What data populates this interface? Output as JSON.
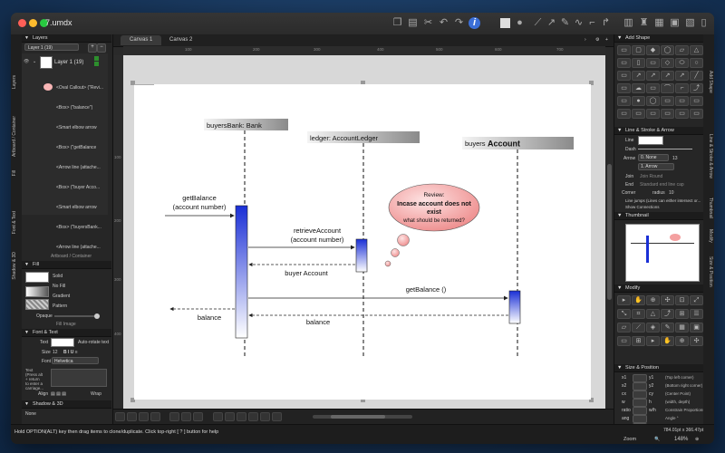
{
  "window": {
    "title": "7.umdx"
  },
  "layers_panel": {
    "title": "Layers",
    "layer_select": "Layer 1 (19)",
    "layer_name": "Layer 1 (19)",
    "items": [
      "<Oval Callout> (\"Revi...",
      "<Box> (\"balance\")",
      "<Smart elbow arrow",
      "<Box> (\"getBalance",
      "<Arrow line (attache...",
      "<Box> (\"buyer Acco...",
      "<Smart elbow arrow",
      "<Box> (\"buyersBank...",
      "<Arrow line (attache..."
    ],
    "artboard_label": "Artboard / Container"
  },
  "left_tabs": [
    "Layers",
    "Artboard / Container",
    "Fill",
    "Font & Text",
    "Shadow & 3D"
  ],
  "fill_panel": {
    "title": "Fill",
    "options": [
      "Solid",
      "No Fill",
      "Gradient",
      "Pattern"
    ],
    "opaque_label": "Opaque",
    "image_label": "Fill Image"
  },
  "font_panel": {
    "title": "Font & Text",
    "text_label": "Text",
    "auto_rotate": "Auto-rotate text",
    "size_label": "Size",
    "size_value": "12",
    "font_label": "Font",
    "font_value": "Helvetica",
    "text_note": "Text\n(Press alt\n+ return\nto enter a\ncarriage...",
    "align_label": "Align",
    "wrap_label": "Wrap",
    "hint_label": "Text"
  },
  "shadow_panel": {
    "title": "Shadow & 3D",
    "none_label": "None",
    "color_label": "Color",
    "angle_label": "Angle",
    "angle_value": "315°",
    "distance_label": "Distance",
    "blur_label": "Blur",
    "opaque_label": "Opaque"
  },
  "canvas_tabs": [
    "Canvas 1",
    "Canvas 2"
  ],
  "ruler_top": [
    "100",
    "200",
    "300",
    "400",
    "500",
    "600",
    "700"
  ],
  "ruler_left": [
    "100",
    "200",
    "300",
    "400"
  ],
  "diagram": {
    "axis_x": "x",
    "axis_y": "y",
    "lifelines": [
      "buyersBank: Bank",
      "ledger: AccountLedger",
      "buyers"
    ],
    "lifeline3_bold": "Account",
    "messages": {
      "get_balance": [
        "getBalance",
        "(account number)"
      ],
      "retrieve": [
        "retrieveAccount",
        "(account number)"
      ],
      "buyer_account": "buyer Account",
      "get_balance2": "getBalance ()",
      "balance_left": "balance",
      "balance_mid": "balance"
    },
    "callout": [
      "Review:",
      "Incase account does not",
      "exist",
      "what should be returned?"
    ]
  },
  "right_tabs": [
    "Add Shape",
    "Line & Stroke & Arrow",
    "Thumbnail",
    "Modify",
    "Size & Position"
  ],
  "add_shape": {
    "title": "Add Shape"
  },
  "line_panel": {
    "title": "Line & Stroke & Arrow",
    "line_label": "Line",
    "dash_label": "Dash",
    "arrow_label": "Arrow",
    "arrow_value": "0. None",
    "arrow_num": "13",
    "arrow_end": "1. Arrow",
    "join_label": "Join",
    "join_value": "Join Round",
    "end_label": "End",
    "end_value": "Standard end line cap",
    "corner_label": "Corner",
    "radius_label": "radius",
    "radius_value": "10",
    "jumps_label": "Line jumps (Lines can either intersect or...",
    "connections_label": "Show Connections"
  },
  "thumbnail": {
    "title": "Thumbnail"
  },
  "modify": {
    "title": "Modify"
  },
  "size_position": {
    "title": "Size & Position",
    "rows": [
      {
        "k": "x1",
        "k2": "y1",
        "v": "(Top left corner)"
      },
      {
        "k": "x2",
        "k2": "y2",
        "v": "(Bottom right corner)"
      },
      {
        "k": "cx",
        "k2": "cy",
        "v": "(Center Point)"
      },
      {
        "k": "w",
        "k2": "h",
        "v": "(width, depth)"
      },
      {
        "k": "ratio",
        "k2": "w/h",
        "v": "Constrain Proportions"
      },
      {
        "k": "ang",
        "k2": "",
        "v": "Angle °"
      },
      {
        "k": "len",
        "k2": "",
        "v": "(Length: From Center)"
      },
      {
        "k": "len",
        "k2": "len2",
        "v": "(Length: From Corner)"
      }
    ]
  },
  "statusbar": {
    "hint": "Hold OPTION(ALT) key then drag items to clone/duplicate.  Click top-right [ ? ] button for help",
    "coords": "784.01pt x 366.47pt",
    "zoom_label": "Zoom",
    "zoom_value": "148%"
  },
  "colors": {
    "window_bg": "#2a2a2a",
    "activation_blue": "#1a2fd6",
    "callout_fill": "#f4a0a0"
  }
}
